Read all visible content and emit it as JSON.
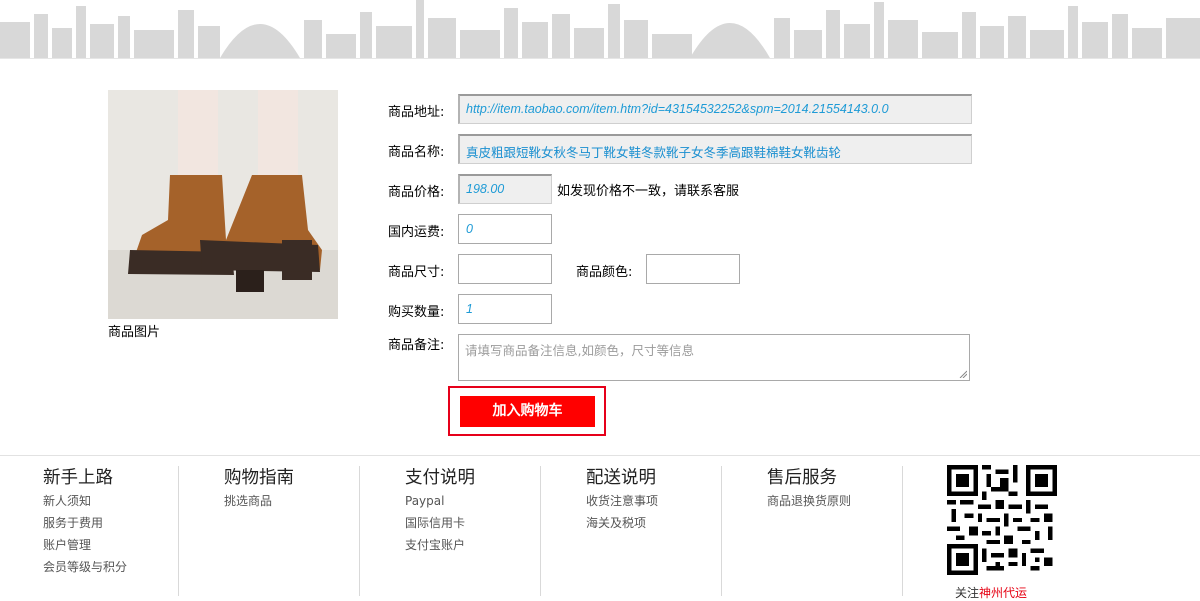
{
  "product": {
    "image_caption": "商品图片",
    "image_icon": "boots-photo"
  },
  "form": {
    "url_label": "商品地址:",
    "url_value": "http://item.taobao.com/item.htm?id=43154532252&spm=2014.21554143.0.0",
    "name_label": "商品名称:",
    "name_value": "真皮粗跟短靴女秋冬马丁靴女鞋冬款靴子女冬季高跟鞋棉鞋女靴齿轮",
    "price_label": "商品价格:",
    "price_value": "198.00",
    "price_note": "如发现价格不一致，请联系客服",
    "shipping_label": "国内运费:",
    "shipping_value": "0",
    "size_label": "商品尺寸:",
    "size_value": "",
    "color_label": "商品颜色:",
    "color_value": "",
    "quantity_label": "购买数量:",
    "quantity_value": "1",
    "remark_label": "商品备注:",
    "remark_placeholder": "请填写商品备注信息,如颜色，尺寸等信息"
  },
  "cart_button": "加入购物车",
  "footer": {
    "columns": [
      {
        "title": "新手上路",
        "links": [
          "新人须知",
          "服务于费用",
          "账户管理",
          "会员等级与积分"
        ]
      },
      {
        "title": "购物指南",
        "links": [
          "挑选商品"
        ]
      },
      {
        "title": "支付说明",
        "links": [
          "Paypal",
          "国际信用卡",
          "支付宝账户"
        ]
      },
      {
        "title": "配送说明",
        "links": [
          "收货注意事项",
          "海关及税项"
        ]
      },
      {
        "title": "售后服务",
        "links": [
          "商品退换货原则"
        ]
      }
    ],
    "qr_prefix": "关注",
    "qr_brand": "神州代运"
  },
  "colors": {
    "accent": "#ff0000",
    "link_blue": "#1f9bd6",
    "brand_red": "#e60012"
  }
}
